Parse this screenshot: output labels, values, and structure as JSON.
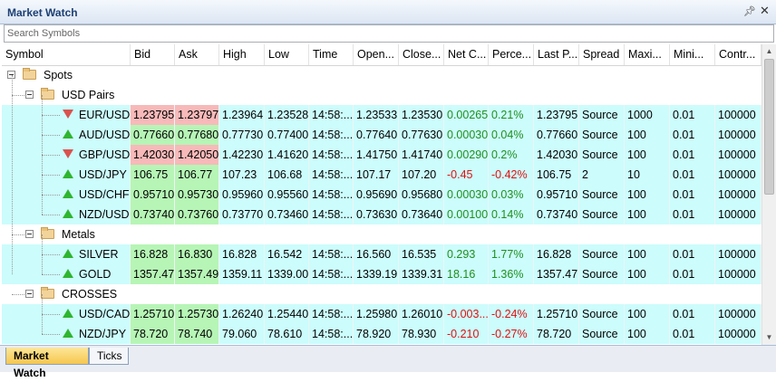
{
  "window": {
    "title": "Market Watch",
    "pin_icon": "pin-icon",
    "close_icon": "close-icon"
  },
  "search": {
    "placeholder": "Search Symbols"
  },
  "columns": [
    "Symbol",
    "Bid",
    "Ask",
    "High",
    "Low",
    "Time",
    "Open...",
    "Close...",
    "Net C...",
    "Perce...",
    "Last P...",
    "Spread",
    "Maxi...",
    "Mini...",
    "Contr..."
  ],
  "groups": [
    {
      "label": "Spots",
      "level": 0
    },
    {
      "label": "USD Pairs",
      "level": 1
    },
    {
      "label": "Metals",
      "level": 1
    },
    {
      "label": "CROSSES",
      "level": 1
    }
  ],
  "rows": [
    {
      "symbol": "EUR/USD",
      "dir": "down",
      "bid": "1.23795",
      "ask": "1.23797",
      "high": "1.23964",
      "low": "1.23528",
      "time": "14:58:...",
      "open": "1.23533",
      "close": "1.23530",
      "net": "0.00265",
      "perc": "0.21%",
      "last": "1.23795",
      "spread": "Source",
      "max": "1000",
      "min": "0.01",
      "contract": "100000"
    },
    {
      "symbol": "AUD/USD",
      "dir": "up",
      "bid": "0.77660",
      "ask": "0.77680",
      "high": "0.77730",
      "low": "0.77400",
      "time": "14:58:...",
      "open": "0.77640",
      "close": "0.77630",
      "net": "0.00030",
      "perc": "0.04%",
      "last": "0.77660",
      "spread": "Source",
      "max": "100",
      "min": "0.01",
      "contract": "100000"
    },
    {
      "symbol": "GBP/USD",
      "dir": "down",
      "bid": "1.42030",
      "ask": "1.42050",
      "high": "1.42230",
      "low": "1.41620",
      "time": "14:58:...",
      "open": "1.41750",
      "close": "1.41740",
      "net": "0.00290",
      "perc": "0.2%",
      "last": "1.42030",
      "spread": "Source",
      "max": "100",
      "min": "0.01",
      "contract": "100000"
    },
    {
      "symbol": "USD/JPY",
      "dir": "up",
      "bid": "106.75",
      "ask": "106.77",
      "high": "107.23",
      "low": "106.68",
      "time": "14:58:...",
      "open": "107.17",
      "close": "107.20",
      "net": "-0.45",
      "perc": "-0.42%",
      "last": "106.75",
      "spread": "2",
      "max": "10",
      "min": "0.01",
      "contract": "100000"
    },
    {
      "symbol": "USD/CHF",
      "dir": "up",
      "bid": "0.95710",
      "ask": "0.95730",
      "high": "0.95960",
      "low": "0.95560",
      "time": "14:58:...",
      "open": "0.95690",
      "close": "0.95680",
      "net": "0.00030",
      "perc": "0.03%",
      "last": "0.95710",
      "spread": "Source",
      "max": "100",
      "min": "0.01",
      "contract": "100000"
    },
    {
      "symbol": "NZD/USD",
      "dir": "up",
      "bid": "0.73740",
      "ask": "0.73760",
      "high": "0.73770",
      "low": "0.73460",
      "time": "14:58:...",
      "open": "0.73630",
      "close": "0.73640",
      "net": "0.00100",
      "perc": "0.14%",
      "last": "0.73740",
      "spread": "Source",
      "max": "100",
      "min": "0.01",
      "contract": "100000"
    },
    {
      "symbol": "SILVER",
      "dir": "up",
      "bid": "16.828",
      "ask": "16.830",
      "high": "16.828",
      "low": "16.542",
      "time": "14:58:...",
      "open": "16.560",
      "close": "16.535",
      "net": "0.293",
      "perc": "1.77%",
      "last": "16.828",
      "spread": "Source",
      "max": "100",
      "min": "0.01",
      "contract": "100000"
    },
    {
      "symbol": "GOLD",
      "dir": "up",
      "bid": "1357.47",
      "ask": "1357.49",
      "high": "1359.11",
      "low": "1339.00",
      "time": "14:58:...",
      "open": "1339.19",
      "close": "1339.31",
      "net": "18.16",
      "perc": "1.36%",
      "last": "1357.47",
      "spread": "Source",
      "max": "100",
      "min": "0.01",
      "contract": "100000"
    },
    {
      "symbol": "USD/CAD",
      "dir": "up",
      "bid": "1.25710",
      "ask": "1.25730",
      "high": "1.26240",
      "low": "1.25440",
      "time": "14:58:...",
      "open": "1.25980",
      "close": "1.26010",
      "net": "-0.003...",
      "perc": "-0.24%",
      "last": "1.25710",
      "spread": "Source",
      "max": "100",
      "min": "0.01",
      "contract": "100000"
    },
    {
      "symbol": "NZD/JPY",
      "dir": "up",
      "bid": "78.720",
      "ask": "78.740",
      "high": "79.060",
      "low": "78.610",
      "time": "14:58:...",
      "open": "78.920",
      "close": "78.930",
      "net": "-0.210",
      "perc": "-0.27%",
      "last": "78.720",
      "spread": "Source",
      "max": "100",
      "min": "0.01",
      "contract": "100000"
    }
  ],
  "tabs": [
    {
      "label": "Market Watch",
      "active": true
    },
    {
      "label": "Ticks",
      "active": false
    }
  ],
  "colors": {
    "row_bg": "#ccfcfc",
    "bid_up": "#b6f5b6",
    "bid_down": "#f7b9b9",
    "positive": "#1f8f1f",
    "negative": "#e01010"
  }
}
